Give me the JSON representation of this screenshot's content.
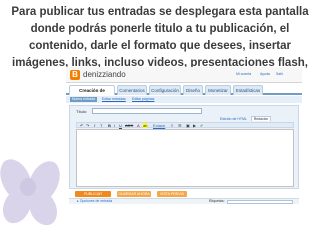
{
  "heading": "Para publicar tus entradas se desplegara esta pantalla donde podrás ponerle titulo a tu publicación, el contenido, darle el formato que desees, insertar imágenes, links, incluso videos, presentaciones flash, etc.",
  "blog": {
    "brand": "denizziando",
    "logo_letter": "B",
    "top_links": [
      "Mi cuenta",
      "Ayuda",
      "Salir"
    ]
  },
  "tabs": [
    {
      "label": "Creación de entradas",
      "active": true
    },
    {
      "label": "Comentarios",
      "active": false
    },
    {
      "label": "Configuración",
      "active": false
    },
    {
      "label": "Diseño",
      "active": false
    },
    {
      "label": "Monetizar",
      "active": false
    },
    {
      "label": "Estadísticas",
      "active": false
    }
  ],
  "subtabs": [
    {
      "label": "Nueva entrada",
      "active": true
    },
    {
      "label": "Editar entradas",
      "active": false
    },
    {
      "label": "Editar páginas",
      "active": false
    }
  ],
  "editor": {
    "title_label": "Título:",
    "mode_html": "Edición de HTML",
    "mode_compose": "Redactar",
    "toolbar_tools": [
      "↶",
      "↷",
      "f",
      "T",
      "B",
      "I",
      "U",
      "ABC",
      "A",
      "ab",
      "Enlace",
      "≡",
      "☰",
      "▣",
      "▶",
      "✔"
    ]
  },
  "actions": {
    "publish": "PUBLICAR ENTRADA",
    "save": "GUARDAR AHORA",
    "preview": "VISTA PREVIA"
  },
  "options": {
    "link": "▸ Opciones de entrada",
    "tags_label": "Etiquetas:"
  }
}
